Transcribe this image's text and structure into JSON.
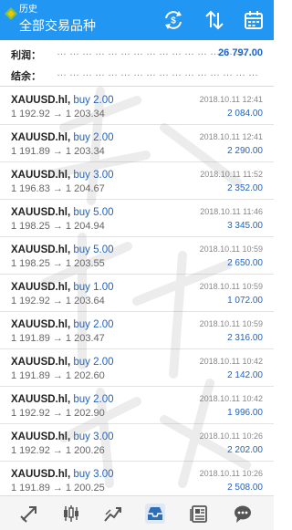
{
  "header": {
    "subtitle": "历史",
    "title": "全部交易品种",
    "icons": [
      "dollar-cycle-icon",
      "sort-arrows-icon",
      "calendar-icon"
    ]
  },
  "summary": {
    "profit_label": "利润：",
    "profit_value": "26 797.00",
    "balance_label": "结余："
  },
  "trades": [
    {
      "symbol": "XAUUSD.hl,",
      "type": "buy 2.00",
      "prices": "1 192.92 → 1 203.34",
      "datetime": "2018.10.11 12:41",
      "profit": "2 084.00"
    },
    {
      "symbol": "XAUUSD.hl,",
      "type": "buy 2.00",
      "prices": "1 191.89 → 1 203.34",
      "datetime": "2018.10.11 12:41",
      "profit": "2 290.00"
    },
    {
      "symbol": "XAUUSD.hl,",
      "type": "buy 3.00",
      "prices": "1 196.83 → 1 204.67",
      "datetime": "2018.10.11 11:52",
      "profit": "2 352.00"
    },
    {
      "symbol": "XAUUSD.hl,",
      "type": "buy 5.00",
      "prices": "1 198.25 → 1 204.94",
      "datetime": "2018.10.11 11:46",
      "profit": "3 345.00"
    },
    {
      "symbol": "XAUUSD.hl,",
      "type": "buy 5.00",
      "prices": "1 198.25 → 1 203.55",
      "datetime": "2018.10.11 10:59",
      "profit": "2 650.00"
    },
    {
      "symbol": "XAUUSD.hl,",
      "type": "buy 1.00",
      "prices": "1 192.92 → 1 203.64",
      "datetime": "2018.10.11 10:59",
      "profit": "1 072.00"
    },
    {
      "symbol": "XAUUSD.hl,",
      "type": "buy 2.00",
      "prices": "1 191.89 → 1 203.47",
      "datetime": "2018.10.11 10:59",
      "profit": "2 316.00"
    },
    {
      "symbol": "XAUUSD.hl,",
      "type": "buy 2.00",
      "prices": "1 191.89 → 1 202.60",
      "datetime": "2018.10.11 10:42",
      "profit": "2 142.00"
    },
    {
      "symbol": "XAUUSD.hl,",
      "type": "buy 2.00",
      "prices": "1 192.92 → 1 202.90",
      "datetime": "2018.10.11 10:42",
      "profit": "1 996.00"
    },
    {
      "symbol": "XAUUSD.hl,",
      "type": "buy 3.00",
      "prices": "1 192.92 → 1 200.26",
      "datetime": "2018.10.11 10:26",
      "profit": "2 202.00"
    },
    {
      "symbol": "XAUUSD.hl,",
      "type": "buy 3.00",
      "prices": "1 191.89 → 1 200.25",
      "datetime": "2018.10.11 10:26",
      "profit": "2 508.00"
    }
  ],
  "bottom_nav": [
    "quotes-icon",
    "chart-icon",
    "trade-icon",
    "history-icon",
    "news-icon",
    "chat-icon"
  ],
  "colors": {
    "header_bg": "#2196f3",
    "accent_blue": "#1e63c9",
    "bottom_bar": "#f5f5f5"
  }
}
